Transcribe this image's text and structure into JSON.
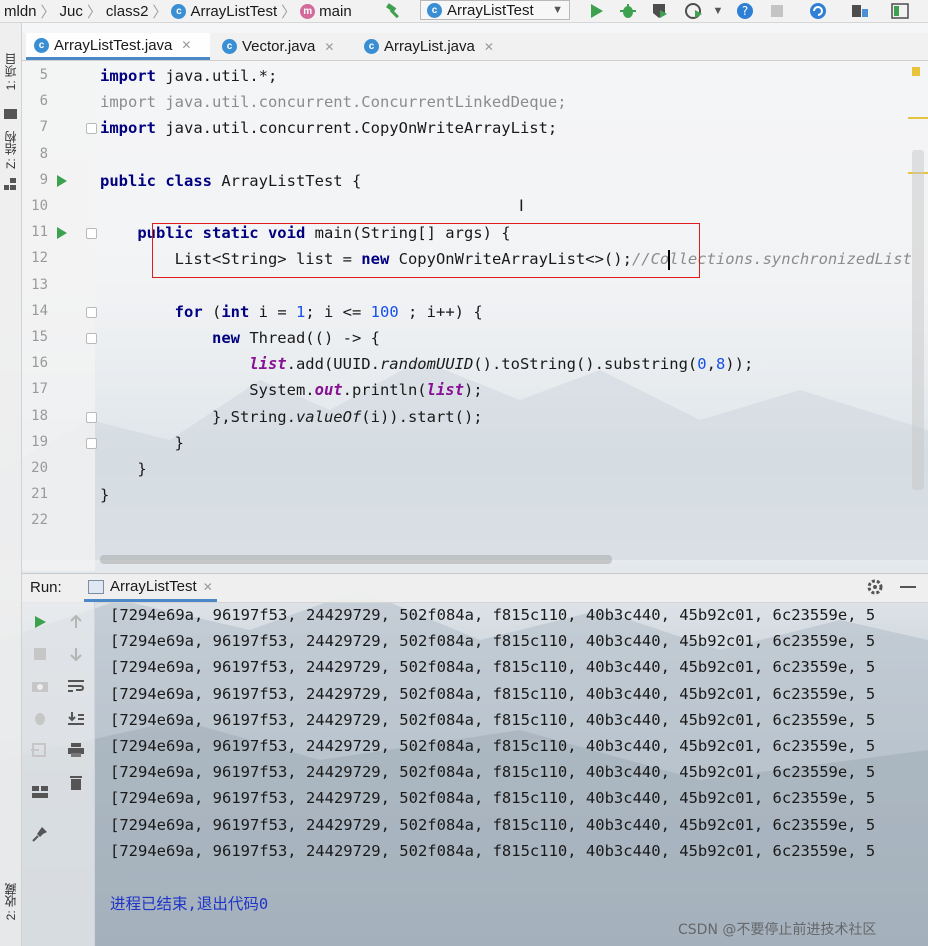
{
  "breadcrumb": {
    "items": [
      "mldn",
      "Juc",
      "class2",
      "ArrayListTest",
      "main"
    ]
  },
  "toolbar": {
    "run_config_label": "ArrayListTest"
  },
  "left_stripe": {
    "project_tab": "1: 项目",
    "structure_tab": "Z: 结构",
    "favorites_tab": "2: 收藏"
  },
  "tabs": [
    {
      "label": "ArrayListTest.java",
      "active": true
    },
    {
      "label": "Vector.java",
      "active": false
    },
    {
      "label": "ArrayList.java",
      "active": false
    }
  ],
  "editor": {
    "line_numbers": [
      "5",
      "6",
      "7",
      "8",
      "9",
      "10",
      "11",
      "12",
      "13",
      "14",
      "15",
      "16",
      "17",
      "18",
      "19",
      "20",
      "21",
      "22"
    ],
    "lines": [
      {
        "parts": [
          {
            "t": "import",
            "c": "kw"
          },
          {
            "t": " java.util.*;",
            "c": ""
          }
        ]
      },
      {
        "parts": [
          {
            "t": "import java.util.concurrent.ConcurrentLinkedDeque;",
            "c": "gray"
          }
        ]
      },
      {
        "parts": [
          {
            "t": "import",
            "c": "kw"
          },
          {
            "t": " java.util.concurrent.CopyOnWriteArrayList;",
            "c": ""
          }
        ]
      },
      {
        "parts": []
      },
      {
        "parts": [
          {
            "t": "public class",
            "c": "kw"
          },
          {
            "t": " ArrayListTest {",
            "c": ""
          }
        ]
      },
      {
        "parts": []
      },
      {
        "parts": [
          {
            "t": "    ",
            "c": ""
          },
          {
            "t": "public static void",
            "c": "kw"
          },
          {
            "t": " main(String[] args) {",
            "c": ""
          }
        ]
      },
      {
        "parts": [
          {
            "t": "        List<String> list = ",
            "c": ""
          },
          {
            "t": "new",
            "c": "kw"
          },
          {
            "t": " CopyOnWriteArrayList<>();",
            "c": ""
          },
          {
            "t": "//Collections.synchronizedList(new ArrayList<>());",
            "c": "cmt"
          }
        ]
      },
      {
        "parts": []
      },
      {
        "parts": [
          {
            "t": "        ",
            "c": ""
          },
          {
            "t": "for",
            "c": "kw"
          },
          {
            "t": " (",
            "c": ""
          },
          {
            "t": "int",
            "c": "kw"
          },
          {
            "t": " i = ",
            "c": ""
          },
          {
            "t": "1",
            "c": "num"
          },
          {
            "t": "; i <= ",
            "c": ""
          },
          {
            "t": "100",
            "c": "num"
          },
          {
            "t": " ; i++) {",
            "c": ""
          }
        ]
      },
      {
        "parts": [
          {
            "t": "            ",
            "c": ""
          },
          {
            "t": "new",
            "c": "kw"
          },
          {
            "t": " Thread(() -> {",
            "c": ""
          }
        ]
      },
      {
        "parts": [
          {
            "t": "                ",
            "c": ""
          },
          {
            "t": "list",
            "c": "field"
          },
          {
            "t": ".add(UUID.",
            "c": ""
          },
          {
            "t": "randomUUID",
            "c": "ital"
          },
          {
            "t": "().toString().substring(",
            "c": ""
          },
          {
            "t": "0",
            "c": "num"
          },
          {
            "t": ",",
            "c": ""
          },
          {
            "t": "8",
            "c": "num"
          },
          {
            "t": "));",
            "c": ""
          }
        ]
      },
      {
        "parts": [
          {
            "t": "                System.",
            "c": ""
          },
          {
            "t": "out",
            "c": "field"
          },
          {
            "t": ".println(",
            "c": ""
          },
          {
            "t": "list",
            "c": "field"
          },
          {
            "t": ");",
            "c": ""
          }
        ]
      },
      {
        "parts": [
          {
            "t": "            },String.",
            "c": ""
          },
          {
            "t": "valueOf",
            "c": "ital"
          },
          {
            "t": "(i)).start();",
            "c": ""
          }
        ]
      },
      {
        "parts": [
          {
            "t": "        }",
            "c": ""
          }
        ]
      },
      {
        "parts": [
          {
            "t": "    }",
            "c": ""
          }
        ]
      },
      {
        "parts": [
          {
            "t": "}",
            "c": ""
          }
        ]
      },
      {
        "parts": []
      }
    ]
  },
  "run_panel": {
    "label": "Run:",
    "tab_label": "ArrayListTest",
    "output_lines": [
      "[7294e69a, 96197f53, 24429729, 502f084a, f815c110, 40b3c440, 45b92c01, 6c23559e, 5",
      "[7294e69a, 96197f53, 24429729, 502f084a, f815c110, 40b3c440, 45b92c01, 6c23559e, 5",
      "[7294e69a, 96197f53, 24429729, 502f084a, f815c110, 40b3c440, 45b92c01, 6c23559e, 5",
      "[7294e69a, 96197f53, 24429729, 502f084a, f815c110, 40b3c440, 45b92c01, 6c23559e, 5",
      "[7294e69a, 96197f53, 24429729, 502f084a, f815c110, 40b3c440, 45b92c01, 6c23559e, 5",
      "[7294e69a, 96197f53, 24429729, 502f084a, f815c110, 40b3c440, 45b92c01, 6c23559e, 5",
      "[7294e69a, 96197f53, 24429729, 502f084a, f815c110, 40b3c440, 45b92c01, 6c23559e, 5",
      "[7294e69a, 96197f53, 24429729, 502f084a, f815c110, 40b3c440, 45b92c01, 6c23559e, 5",
      "[7294e69a, 96197f53, 24429729, 502f084a, f815c110, 40b3c440, 45b92c01, 6c23559e, 5",
      "[7294e69a, 96197f53, 24429729, 502f084a, f815c110, 40b3c440, 45b92c01, 6c23559e, 5"
    ],
    "exit_message": "进程已结束,退出代码0"
  },
  "watermark": "CSDN @不要停止前进技术社区",
  "colors": {
    "keyword": "#000080",
    "number": "#1750eb",
    "field": "#871094",
    "highlight_box": "#e01b1b",
    "run_green": "#3ea14f",
    "exit_text": "#1f35c8"
  }
}
